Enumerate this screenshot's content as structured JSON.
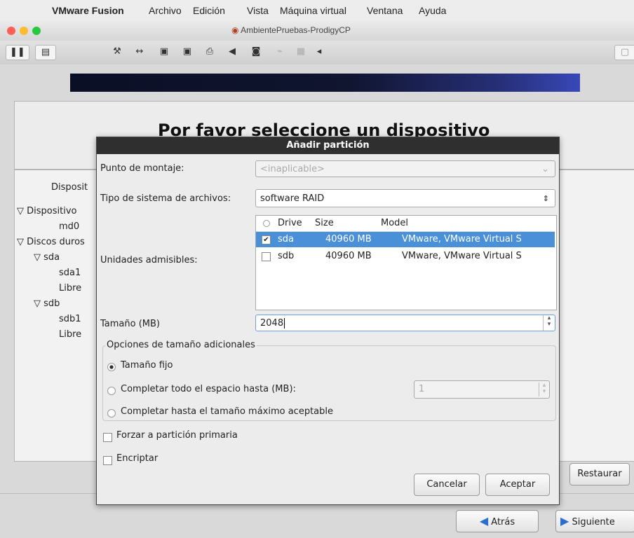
{
  "menubar": {
    "app": "VMware Fusion",
    "items": [
      "Archivo",
      "Edición",
      "Vista",
      "Máquina virtual",
      "Ventana",
      "Ayuda"
    ]
  },
  "window": {
    "title": "AmbientePruebas-ProdigyCP"
  },
  "installer": {
    "title": "Por favor seleccione un dispositivo",
    "devices_header": "Disposit",
    "tree": [
      {
        "label": "Dispositivo",
        "indent": 0,
        "arrow": "▽"
      },
      {
        "label": "md0",
        "indent": 2,
        "arrow": ""
      },
      {
        "label": "Discos duros",
        "indent": 0,
        "arrow": "▽"
      },
      {
        "label": "sda",
        "indent": 1,
        "arrow": "▽"
      },
      {
        "label": "sda1",
        "indent": 2,
        "arrow": ""
      },
      {
        "label": "Libre",
        "indent": 2,
        "arrow": ""
      },
      {
        "label": "sdb",
        "indent": 1,
        "arrow": "▽"
      },
      {
        "label": "sdb1",
        "indent": 2,
        "arrow": ""
      },
      {
        "label": "Libre",
        "indent": 2,
        "arrow": ""
      }
    ],
    "restore_button": "Restaurar",
    "back_button": "Atrás",
    "next_button": "Siguiente"
  },
  "dialog": {
    "title": "Añadir partición",
    "mount_label": "Punto de montaje:",
    "mount_value": "<inaplicable>",
    "fstype_label": "Tipo de sistema de archivos:",
    "fstype_value": "software RAID",
    "drives_label": "Unidades admisibles:",
    "drives_columns": {
      "drive": "Drive",
      "size": "Size",
      "model": "Model"
    },
    "drives": [
      {
        "drive": "sda",
        "size": "40960 MB",
        "model": "VMware, VMware Virtual S",
        "checked": true,
        "selected": true
      },
      {
        "drive": "sdb",
        "size": "40960 MB",
        "model": "VMware, VMware Virtual S",
        "checked": false,
        "selected": false
      }
    ],
    "size_label": "Tamaño (MB)",
    "size_value": "2048",
    "extra_options_legend": "Opciones de tamaño adicionales",
    "opt_fixed": "Tamaño fijo",
    "opt_fill_up_to": "Completar todo el espacio hasta (MB):",
    "opt_fill_up_to_value": "1",
    "opt_fill_max": "Completar hasta el tamaño máximo aceptable",
    "force_primary": "Forzar a partición primaria",
    "encrypt": "Encriptar",
    "cancel": "Cancelar",
    "accept": "Aceptar"
  },
  "colors": {
    "selection": "#4a90d9",
    "dialog_title_bg": "#2f2f2f"
  }
}
